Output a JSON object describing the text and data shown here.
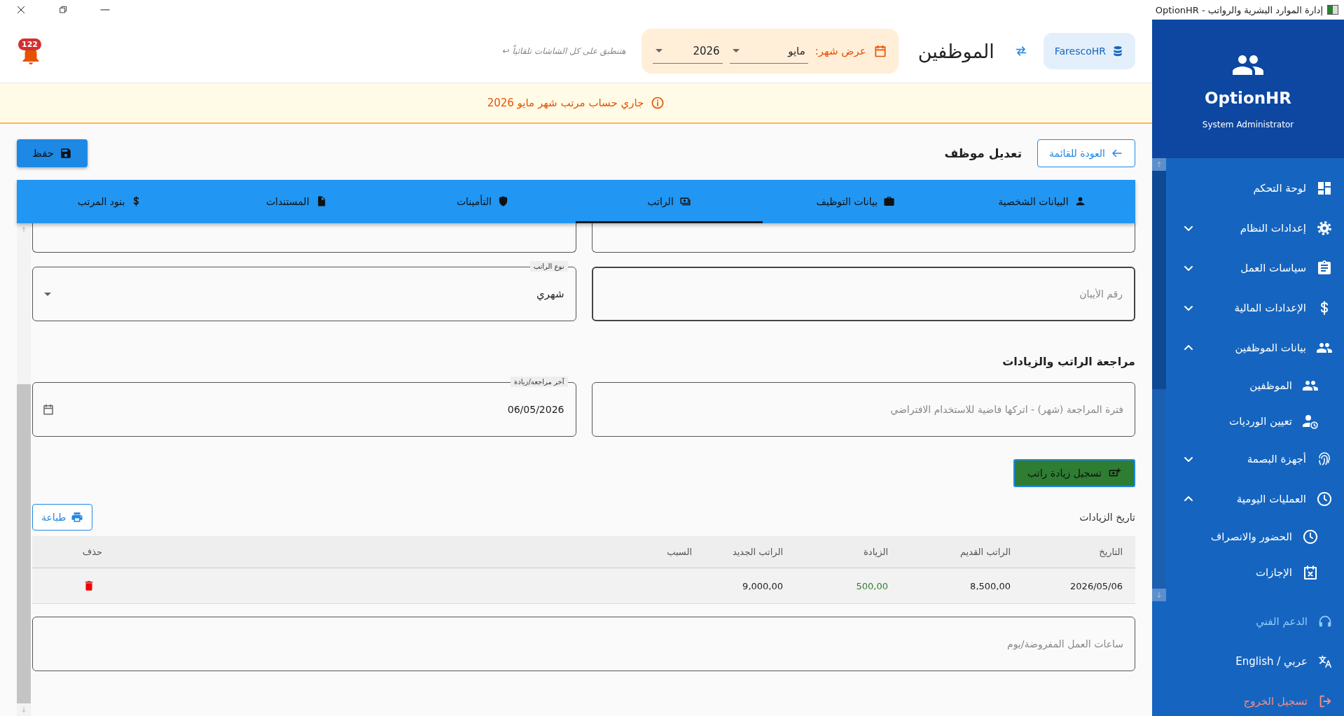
{
  "window": {
    "title": "OptionHR - إدارة الموارد البشرية والرواتب"
  },
  "header": {
    "notifications": "122",
    "hint": "هتنطبق على كل الشاشات تلقائياً ↩",
    "month_label": "عرض شهر:",
    "month": "مايو",
    "year": "2026",
    "page_title": "الموظفين",
    "company": "FarescoHR"
  },
  "banner": {
    "message": "جاري حساب مرتب شهر مايو 2026"
  },
  "toolbar": {
    "back": "العودة للقائمة",
    "title": "تعديل موظف",
    "save": "حفظ"
  },
  "tabs": [
    {
      "label": "البيانات الشخصية",
      "selected": false
    },
    {
      "label": "بيانات التوظيف",
      "selected": false
    },
    {
      "label": "الراتب",
      "selected": true
    },
    {
      "label": "التأمينات",
      "selected": false
    },
    {
      "label": "المستندات",
      "selected": false
    },
    {
      "label": "بنود المرتب",
      "selected": false
    }
  ],
  "salary": {
    "iban": {
      "placeholder": "رقم الأيبان"
    },
    "salary_type": {
      "label": "نوع الراتب",
      "value": "شهري"
    }
  },
  "review": {
    "title": "مراجعة الراتب والزيادات",
    "period": {
      "placeholder": "فترة المراجعة (شهر) - اتركها فاضية للاستخدام الافتراضي"
    },
    "last_review": {
      "label": "آخر مراجعة/زيادة",
      "value": "06/05/2026"
    },
    "add_raise": "تسجيل زيادة راتب"
  },
  "history": {
    "title": "تاريخ الزيادات",
    "print": "طباعة",
    "columns": [
      "التاريخ",
      "الراتب القديم",
      "الزيادة",
      "الراتب الجديد",
      "السبب",
      "حذف"
    ],
    "rows": [
      {
        "cells": [
          "2026/05/06",
          "8,500,00",
          "500,00",
          "9,000,00"
        ]
      }
    ]
  },
  "work_hours": {
    "placeholder": "ساعات العمل المفروضة/يوم"
  },
  "sidebar": {
    "app_name": "OptionHR",
    "role": "System Administrator",
    "items": [
      {
        "label": "لوحة التحكم"
      },
      {
        "label": "إعدادات النظام",
        "expanded": false
      },
      {
        "label": "سياسات العمل",
        "expanded": false
      },
      {
        "label": "الإعدادات المالية",
        "expanded": false
      },
      {
        "label": "بيانات الموظفين",
        "expanded": true,
        "children": [
          {
            "label": "الموظفين"
          },
          {
            "label": "تعيين الورديات"
          }
        ]
      },
      {
        "label": "أجهزة البصمة",
        "expanded": false
      },
      {
        "label": "العمليات اليومية",
        "expanded": true,
        "children": [
          {
            "label": "الحضور والانصراف"
          },
          {
            "label": "الإجازات"
          }
        ]
      }
    ],
    "footer": [
      {
        "kind": "support",
        "label": "الدعم الفني"
      },
      {
        "kind": "language",
        "label": "عربي / English"
      },
      {
        "kind": "logout",
        "label": "تسجيل الخروج"
      }
    ]
  }
}
